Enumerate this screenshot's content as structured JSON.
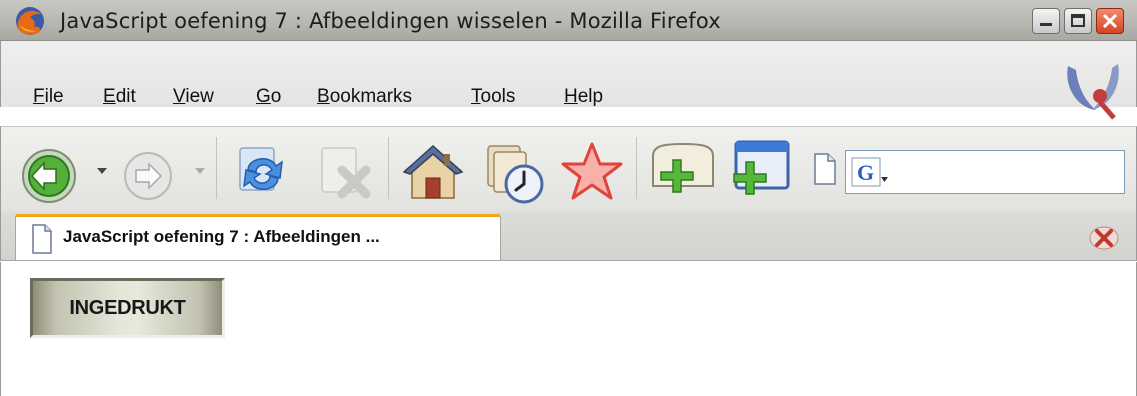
{
  "window": {
    "title": "JavaScript oefening 7 : Afbeeldingen wisselen - Mozilla Firefox"
  },
  "menu": {
    "items": [
      "File",
      "Edit",
      "View",
      "Go",
      "Bookmarks",
      "Tools",
      "Help"
    ]
  },
  "toolbar": {
    "icons": [
      "back-icon",
      "forward-icon",
      "reload-icon",
      "stop-icon",
      "home-icon",
      "history-icon",
      "bookmark-star-icon",
      "new-tab-icon",
      "new-window-icon",
      "page-icon",
      "google-search-icon"
    ],
    "search_value": ""
  },
  "tabs": [
    {
      "label": "JavaScript oefening 7 : Afbeeldingen ...",
      "active": true
    }
  ],
  "content": {
    "button_label": "INGEDRUKT"
  },
  "colors": {
    "tab_accent": "#f2a41a",
    "close_button": "#d5451f"
  }
}
